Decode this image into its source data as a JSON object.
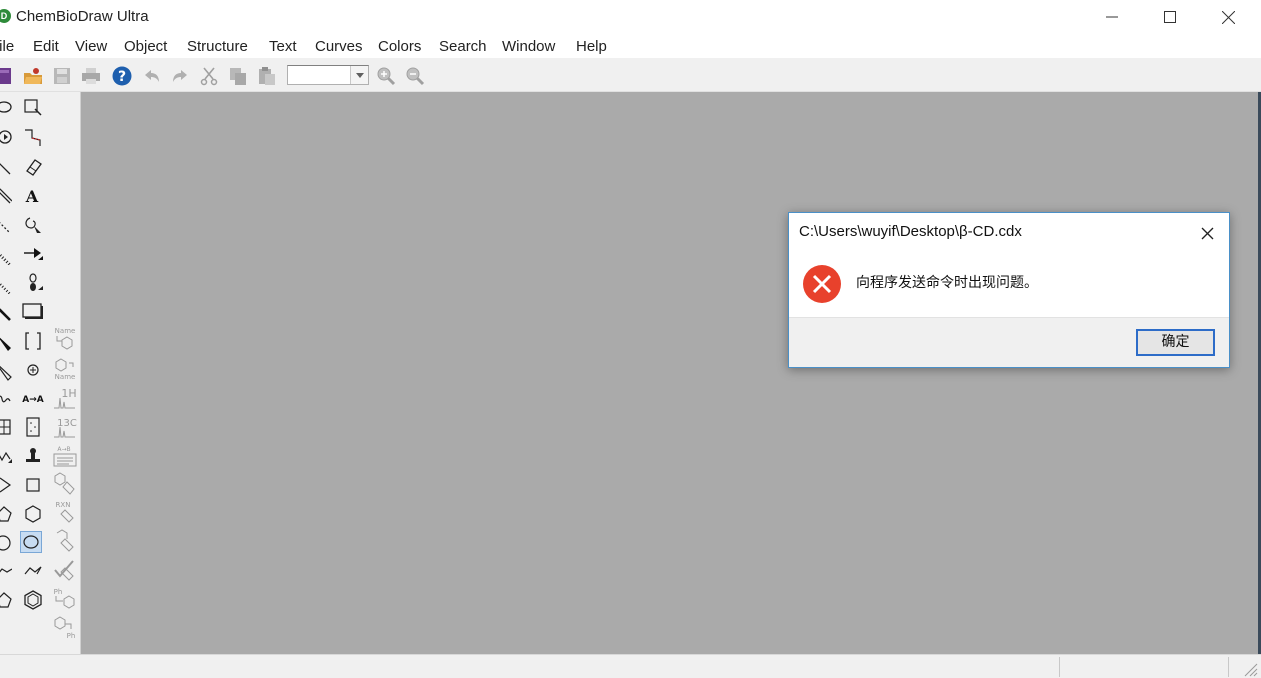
{
  "window": {
    "title": "ChemBioDraw Ultra",
    "app_icon_letter": "D"
  },
  "menu": {
    "items": [
      "File",
      "Edit",
      "View",
      "Object",
      "Structure",
      "Text",
      "Curves",
      "Colors",
      "Search",
      "Window",
      "Help"
    ]
  },
  "toolbar": {
    "zoom_value": "",
    "icons": [
      "new-document-icon",
      "open-icon",
      "save-icon",
      "print-icon",
      "help-icon",
      "undo-icon",
      "redo-icon",
      "cut-icon",
      "copy-icon",
      "paste-icon",
      "zoom-in-icon",
      "zoom-out-icon"
    ]
  },
  "palette": {
    "text_tool_label": "A",
    "map_tool_label": "A→A",
    "name_label": "Name",
    "h_nmr_label": "1H",
    "c_nmr_label": "13C",
    "ab_label": "A→B",
    "rxn_label": "RXN",
    "ph_label": "Ph"
  },
  "dialog": {
    "title": "C:\\Users\\wuyif\\Desktop\\β-CD.cdx",
    "message": "向程序发送命令时出现问题。",
    "ok_label": "确定"
  },
  "colors": {
    "canvas": "#aaaaaa",
    "error_red": "#e8412c",
    "accent_blue": "#2d6cc8"
  }
}
